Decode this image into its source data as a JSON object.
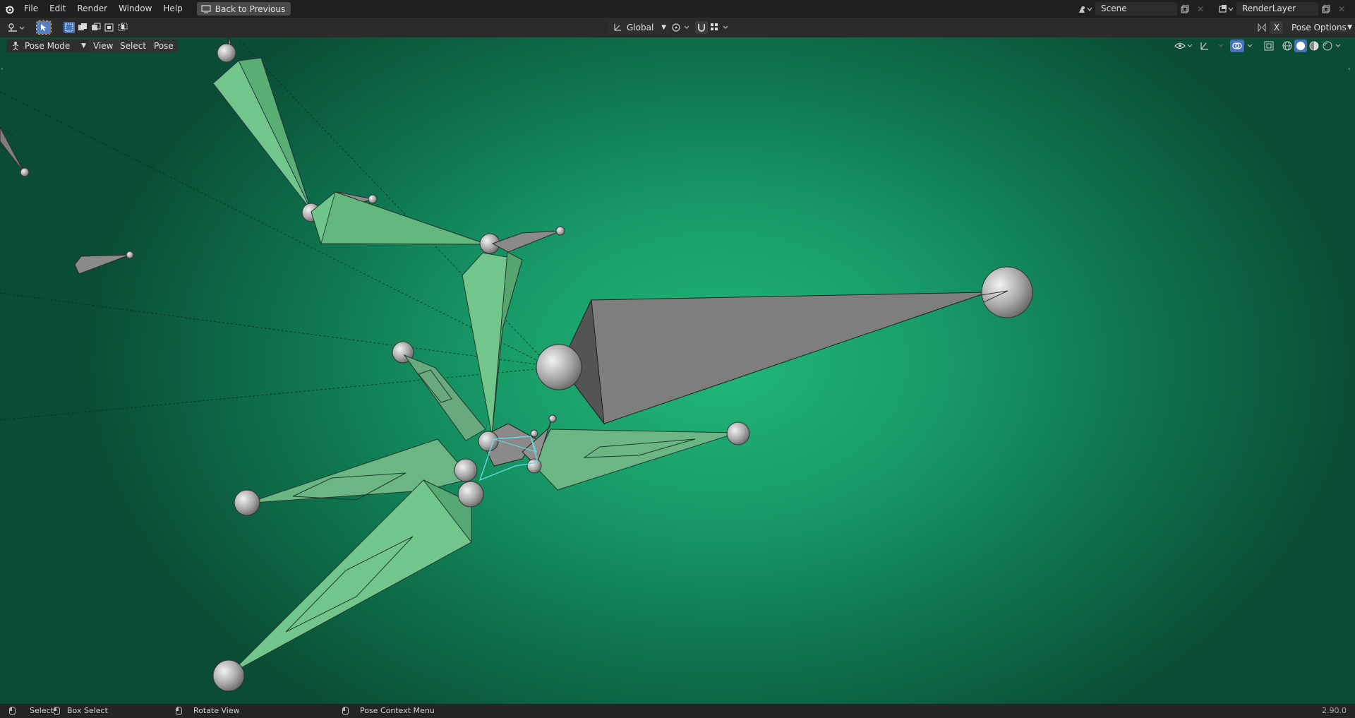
{
  "menubar": {
    "items": [
      "File",
      "Edit",
      "Render",
      "Window",
      "Help"
    ],
    "back_button": "Back to Previous",
    "scene_name": "Scene",
    "view_layer": "RenderLayer"
  },
  "toolheader": {
    "transform_orientation": "Global",
    "pose_options": "Pose Options",
    "x_mirror": "X"
  },
  "viewport_header": {
    "mode": "Pose Mode",
    "menus": [
      "View",
      "Select",
      "Pose"
    ]
  },
  "statusbar": {
    "select": "Select",
    "box_select": "Box Select",
    "rotate_view": "Rotate View",
    "pose_context_menu": "Pose Context Menu",
    "version": "2.90.0"
  },
  "colors": {
    "viewport_center": "#21b779",
    "viewport_edge": "#0a4d34",
    "bone_green": "#6fc58c",
    "bone_gray": "#7e7e7e",
    "selection_cyan": "#5fe0e6"
  }
}
